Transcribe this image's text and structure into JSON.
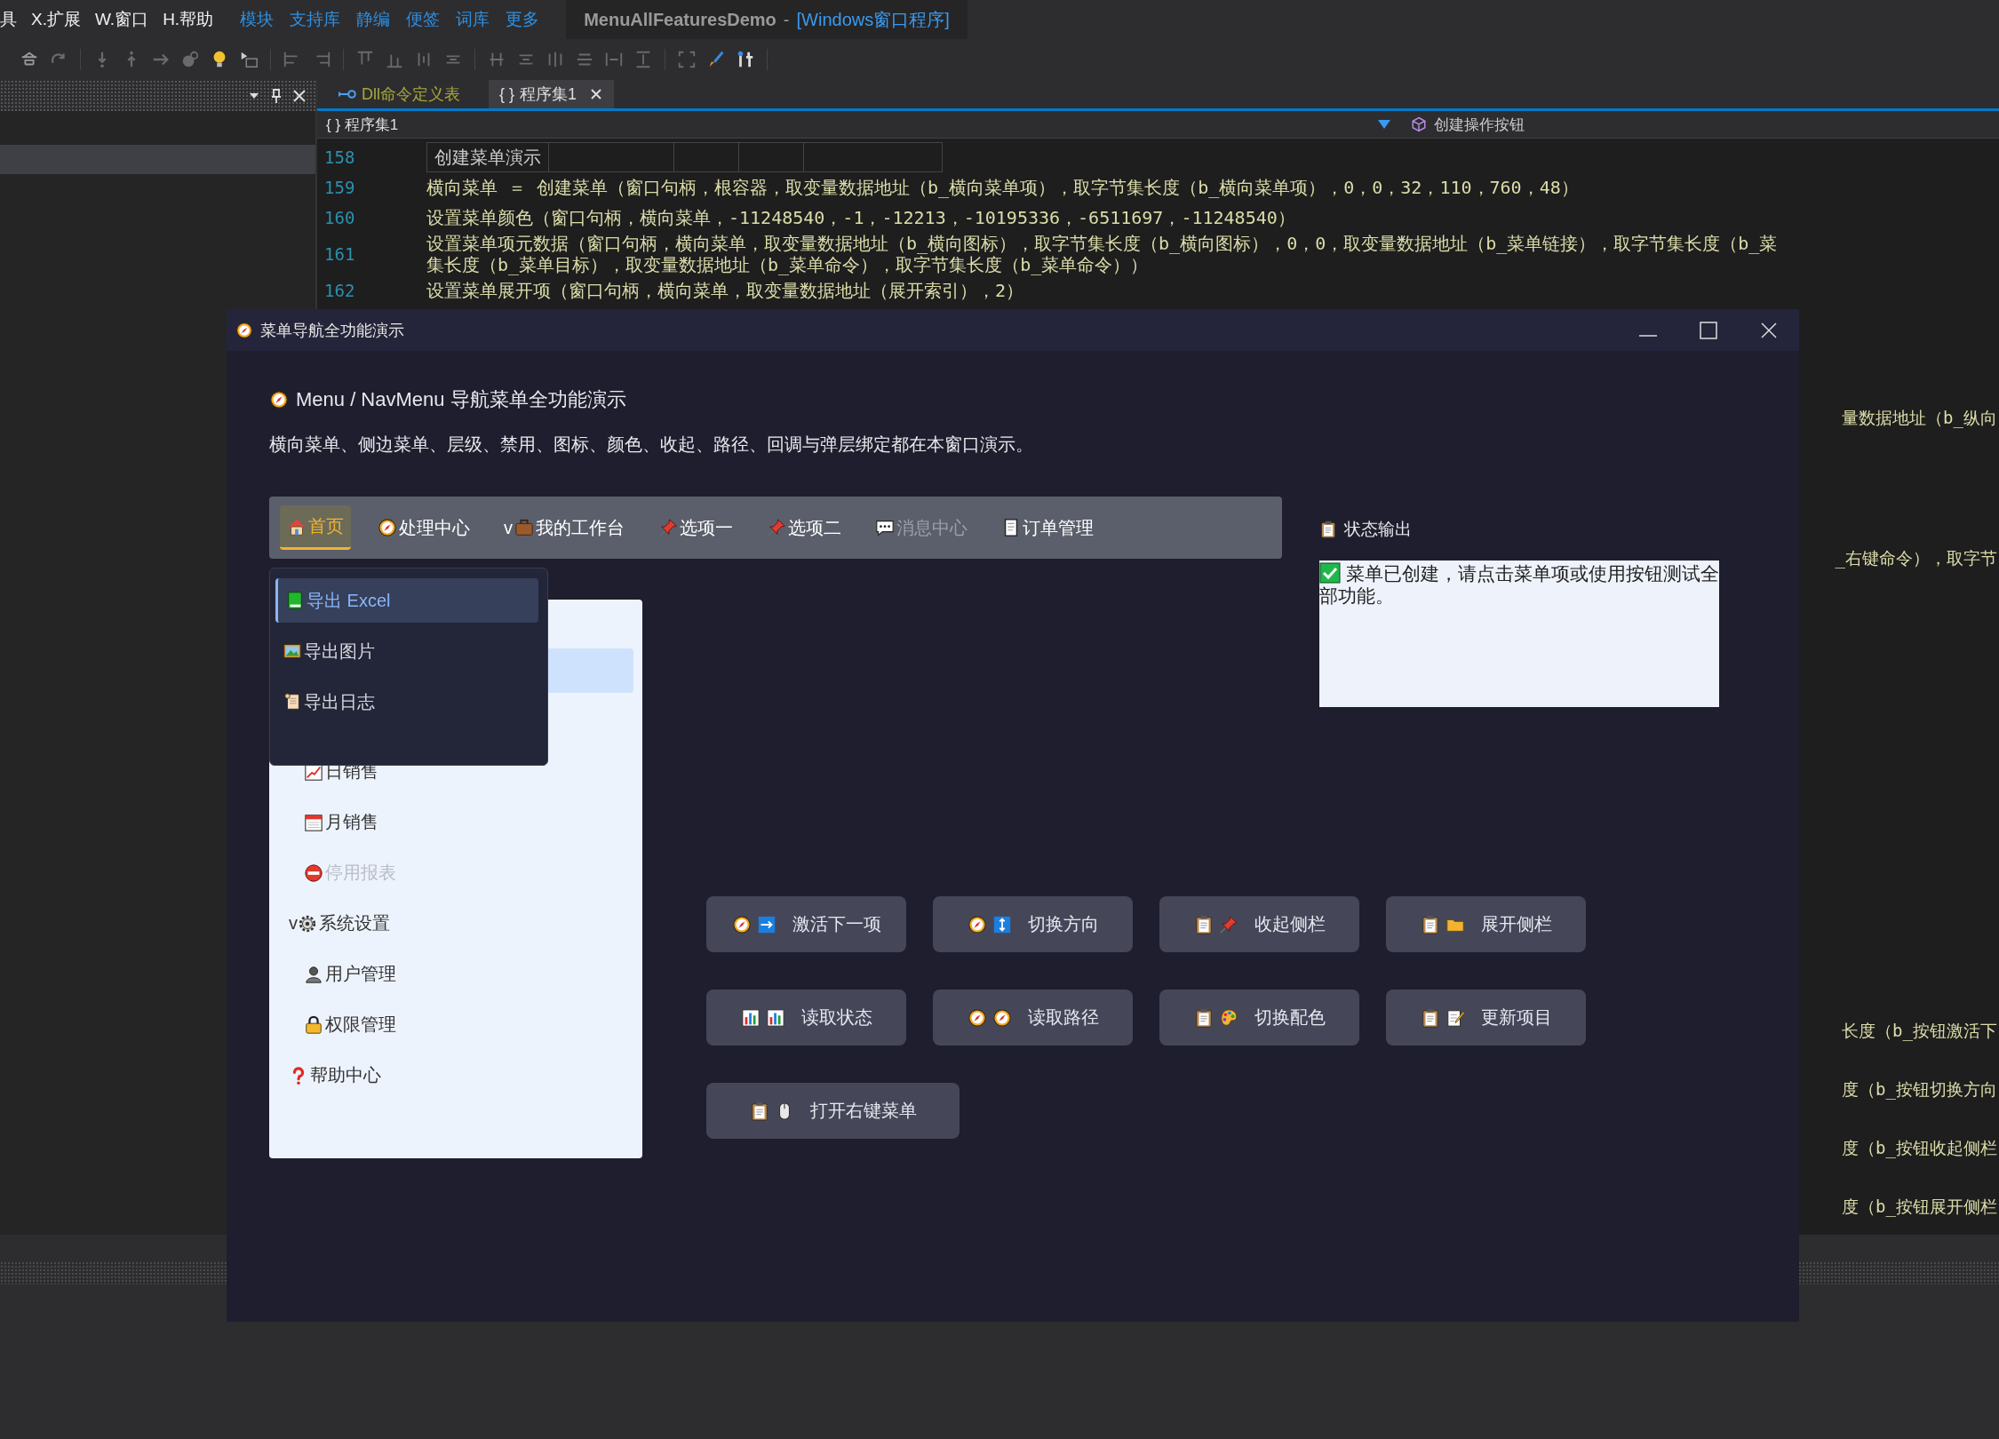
{
  "ide": {
    "menu": [
      {
        "label": "具"
      },
      {
        "label": "X.扩展"
      },
      {
        "label": "W.窗口"
      },
      {
        "label": "H.帮助"
      }
    ],
    "quick_links": [
      "模块",
      "支持库",
      "静编",
      "便签",
      "词库",
      "更多"
    ],
    "title": "MenuAllFeaturesDemo",
    "title_separator": "-",
    "title_kind": "[Windows窗口程序]",
    "tabs": [
      {
        "kind": "dll",
        "label": "Dll命令定义表",
        "selected": false
      },
      {
        "kind": "code",
        "prefix": "{ }",
        "label": "程序集1",
        "selected": true
      }
    ],
    "breadcrumb": {
      "prefix": "{ }",
      "label": "程序集1",
      "member": "创建操作按钮"
    },
    "editor": {
      "lines": [
        {
          "number": "158",
          "kind": "table",
          "cells": [
            "创建菜单演示"
          ]
        },
        {
          "number": "159",
          "kind": "code",
          "text": "横向菜单 ＝ 创建菜单（窗口句柄，根容器，取变量数据地址（b_横向菜单项），取字节集长度（b_横向菜单项），0，0，32，110，760，48）"
        },
        {
          "number": "160",
          "kind": "code",
          "text": "设置菜单颜色（窗口句柄，横向菜单，-11248540，-1，-12213，-10195336，-6511697，-11248540）"
        },
        {
          "number": "161",
          "kind": "code",
          "text": "设置菜单项元数据（窗口句柄，横向菜单，取变量数据地址（b_横向图标），取字节集长度（b_横向图标），0，0，取变量数据地址（b_菜单链接），取字节集长度（b_菜",
          "continuation": "集长度（b_菜单目标），取变量数据地址（b_菜单命令），取字节集长度（b_菜单命令））"
        },
        {
          "number": "162",
          "kind": "code",
          "text": "设置菜单展开项（窗口句柄，横向菜单，取变量数据地址（展开索引），2）"
        }
      ],
      "fragments": [
        "量数据地址（b_纵向",
        "_右键命令），取字节",
        "长度（b_按钮激活下",
        "度（b_按钮切换方向",
        "度（b_按钮收起侧栏",
        "度（b_按钮展开侧栏"
      ]
    }
  },
  "window": {
    "title": "菜单导航全功能演示",
    "heading": "Menu / NavMenu 导航菜单全功能演示",
    "description": "横向菜单、侧边菜单、层级、禁用、图标、颜色、收起、路径、回调与弹层绑定都在本窗口演示。",
    "menubar": [
      {
        "label": "首页",
        "selected": true,
        "disabled": false
      },
      {
        "label": "处理中心",
        "selected": false,
        "disabled": false
      },
      {
        "marker": "v",
        "label": "我的工作台",
        "selected": false,
        "disabled": false
      },
      {
        "label": "选项一",
        "selected": false,
        "disabled": false
      },
      {
        "label": "选项二",
        "selected": false,
        "disabled": false
      },
      {
        "label": "消息中心",
        "selected": false,
        "disabled": true
      },
      {
        "label": "订单管理",
        "selected": false,
        "disabled": false
      }
    ],
    "dropdown": [
      {
        "label": "导出 Excel",
        "selected": true
      },
      {
        "label": "导出图片",
        "selected": false
      },
      {
        "label": "导出日志",
        "selected": false
      }
    ],
    "side_menu": [
      {
        "selected": true
      },
      {
        "selected": false,
        "children": [
          {
            "label": "日销售",
            "selected": false,
            "disabled": false
          },
          {
            "label": "月销售",
            "selected": false,
            "disabled": false
          },
          {
            "label": "停用报表",
            "selected": false,
            "disabled": true
          }
        ]
      },
      {
        "marker": "v",
        "label": "系统设置",
        "selected": false,
        "disabled": false,
        "expanded": true,
        "children": [
          {
            "label": "用户管理",
            "selected": false,
            "disabled": false
          },
          {
            "label": "权限管理",
            "selected": false,
            "disabled": false
          }
        ]
      },
      {
        "label": "帮助中心",
        "selected": false,
        "disabled": false
      }
    ],
    "status": {
      "label": "状态输出",
      "message": "菜单已创建，请点击菜单项或使用按钮测试全部功能。"
    },
    "buttons": [
      "激活下一项",
      "切换方向",
      "收起侧栏",
      "展开侧栏",
      "读取状态",
      "读取路径",
      "切换配色",
      "更新项目",
      "打开右键菜单"
    ]
  }
}
